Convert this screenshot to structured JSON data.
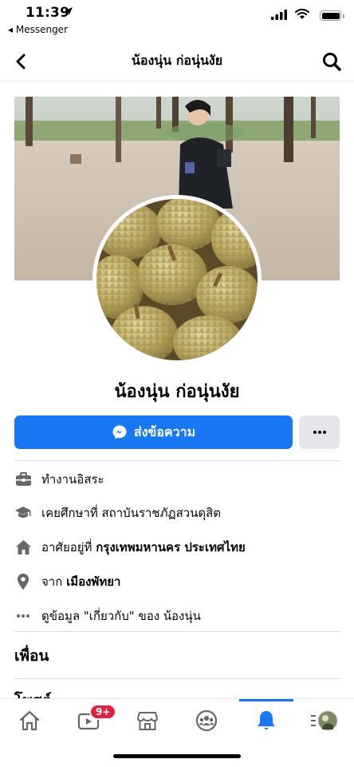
{
  "status_bar": {
    "time": "11:39",
    "back_app": "◂ Messenger"
  },
  "header": {
    "title": "น้องนุ่น ก่อนุ่นงัย"
  },
  "profile": {
    "name": "น้องนุ่น ก่อนุ่นงัย"
  },
  "actions": {
    "message_label": "ส่งข้อความ",
    "more_label": "···"
  },
  "info": {
    "work": "ทำงานอิสระ",
    "education": "เคยศึกษาที่ สถาบันราชภัฏสวนดุสิต",
    "lives_prefix": "อาศัยอยู่ที่",
    "lives_place": "กรุงเทพมหานคร ประเทศไทย",
    "from_prefix": "จาก",
    "from_place": "เมืองพัทยา",
    "about_text": "ดูข้อมูล \"เกี่ยวกับ\" ของ น้องนุ่น"
  },
  "sections": {
    "friends": "เพื่อน",
    "posts": "โพสต์"
  },
  "tabbar": {
    "video_badge": "9+"
  },
  "colors": {
    "accent": "#1877f2",
    "badge": "#e41e3f",
    "icon": "#65676b"
  }
}
